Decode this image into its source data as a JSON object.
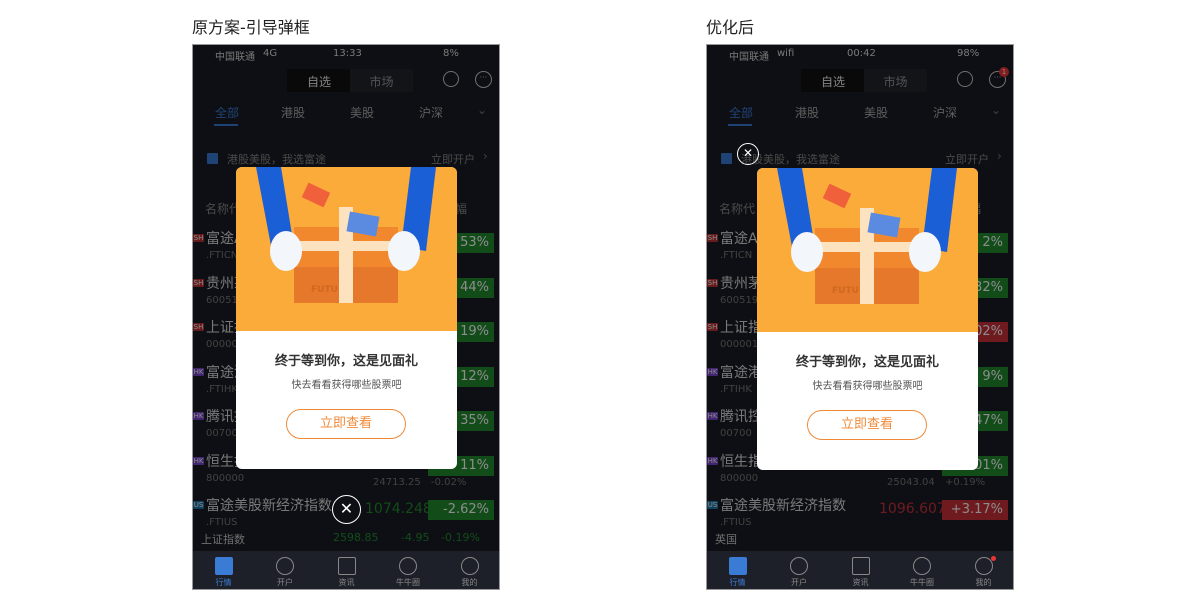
{
  "captions": [
    "原方案-引导弹框",
    "优化后"
  ],
  "colors": {
    "green": "#1f8a2e",
    "red": "#c9303a",
    "orange": "#fbab3a",
    "blue": "#3a7bd5",
    "button": "#f08a3a"
  },
  "phones": [
    {
      "status": {
        "carrier": "中国联通",
        "network": "4G",
        "time": "13:33",
        "battery": "8%"
      },
      "top_tabs": [
        "自选",
        "市场"
      ],
      "msg_badge": "",
      "market_tabs": [
        "全部",
        "港股",
        "美股",
        "沪深"
      ],
      "banner": {
        "text": "港股美股，我选富途",
        "action": "立即开户"
      },
      "list_header": {
        "left": "名称代",
        "right": "幅"
      },
      "rows": [
        {
          "mkt": "SH",
          "name": "富途A",
          "code": ".FTICN",
          "pct": "53%",
          "dir": "green"
        },
        {
          "mkt": "SH",
          "name": "贵州茅",
          "code": "60051",
          "pct": "44%",
          "dir": "green"
        },
        {
          "mkt": "SH",
          "name": "上证指",
          "code": "00000",
          "pct": "19%",
          "dir": "green"
        },
        {
          "mkt": "HK",
          "name": "富途港",
          "code": ".FTIHK",
          "pct": "12%",
          "dir": "green"
        },
        {
          "mkt": "HK",
          "name": "腾讯控",
          "code": "00700",
          "pct": "35%",
          "dir": "green"
        },
        {
          "mkt": "HK",
          "name": "恒生指",
          "code": "800000",
          "pct": "11%",
          "dir": "green",
          "price": "24713.25",
          "chg": "-0.02%"
        },
        {
          "mkt": "US",
          "name": "富途美股新经济指数",
          "code": ".FTIUS",
          "pct": "-2.62%",
          "dir": "green",
          "price": "1074.248"
        }
      ],
      "footer_index": {
        "name": "上证指数",
        "price": "2598.85",
        "chg": "-4.95",
        "pct": "-0.19%"
      },
      "modal": {
        "title": "终于等到你，这是见面礼",
        "subtitle": "快去看看获得哪些股票吧",
        "button": "立即查看",
        "logo": "FUTU"
      },
      "close_pos": "bottom",
      "tabbar": [
        "行情",
        "开户",
        "资讯",
        "牛牛圈",
        "我的"
      ]
    },
    {
      "status": {
        "carrier": "中国联通",
        "network": "wifi",
        "time": "00:42",
        "battery": "98%"
      },
      "top_tabs": [
        "自选",
        "市场"
      ],
      "msg_badge": "1",
      "market_tabs": [
        "全部",
        "港股",
        "美股",
        "沪深"
      ],
      "banner": {
        "text": "港股美股，我选富途",
        "action": "立即开户"
      },
      "list_header": {
        "left": "名称代",
        "right": "幅"
      },
      "rows": [
        {
          "mkt": "SH",
          "name": "富途A",
          "code": ".FTICN",
          "pct": "2%",
          "dir": "green"
        },
        {
          "mkt": "SH",
          "name": "贵州茅",
          "code": "600519",
          "pct": "32%",
          "dir": "green"
        },
        {
          "mkt": "SH",
          "name": "上证指",
          "code": "000001",
          "pct": "02%",
          "dir": "red"
        },
        {
          "mkt": "HK",
          "name": "富途港",
          "code": ".FTIHK",
          "pct": "9%",
          "dir": "green"
        },
        {
          "mkt": "HK",
          "name": "腾讯控",
          "code": "00700",
          "pct": "47%",
          "dir": "green"
        },
        {
          "mkt": "HK",
          "name": "恒生指",
          "code": "800000",
          "pct": "01%",
          "dir": "green",
          "price": "25043.04",
          "chg": "+0.19%"
        },
        {
          "mkt": "US",
          "name": "富途美股新经济指数",
          "code": ".FTIUS",
          "pct": "+3.17%",
          "dir": "red",
          "price": "1096.607"
        }
      ],
      "footer_index": {
        "name": "英国",
        "price": "",
        "chg": "",
        "pct": ""
      },
      "modal": {
        "title": "终于等到你，这是见面礼",
        "subtitle": "快去看看获得哪些股票吧",
        "button": "立即查看",
        "logo": "FUTU"
      },
      "close_pos": "top-left",
      "tabbar": [
        "行情",
        "开户",
        "资讯",
        "牛牛圈",
        "我的"
      ]
    }
  ]
}
